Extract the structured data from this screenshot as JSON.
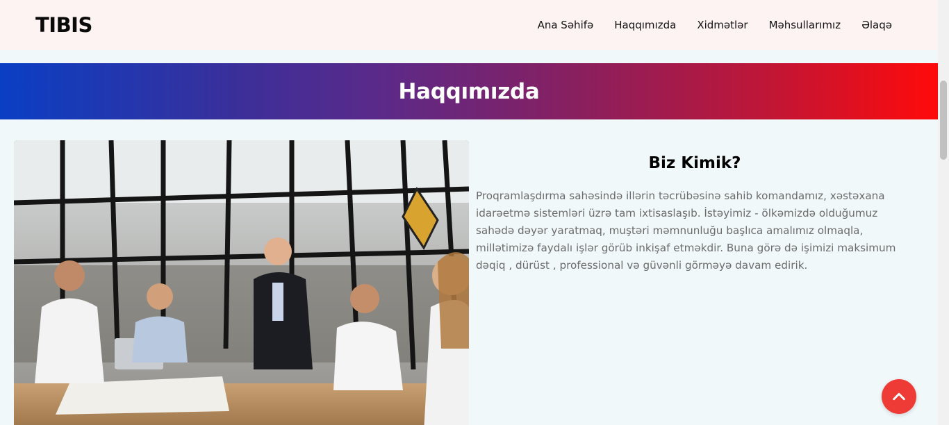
{
  "header": {
    "logo": "TIBIS",
    "nav": [
      {
        "label": "Ana Səhifə"
      },
      {
        "label": "Haqqımızda"
      },
      {
        "label": "Xidmətlər"
      },
      {
        "label": "Məhsullarımız"
      },
      {
        "label": "Əlaqə"
      }
    ]
  },
  "banner": {
    "title": "Haqqımızda"
  },
  "about": {
    "heading": "Biz Kimik?",
    "text": "Proqramlaşdırma sahəsində illərin təcrübəsinə sahib komandamız, xəstəxana idarəetmə sistemləri üzrə tam ixtisaslaşıb. İstəyimiz - ölkəmizdə olduğumuz sahədə dəyər yaratmaq, muştəri məmnunluğu başlıca amalımız olmaqla, millətimizə faydalı işlər görüb inkişaf etməkdir. Buna görə də işimizi maksimum dəqiq , dürüst , professional və güvənli görməyə davam edirik."
  },
  "icons": {
    "scroll_top": "chevron-up-icon"
  },
  "colors": {
    "accent": "#ef3b35",
    "banner_start": "#0a3fc4",
    "banner_end": "#ff0a0a"
  }
}
